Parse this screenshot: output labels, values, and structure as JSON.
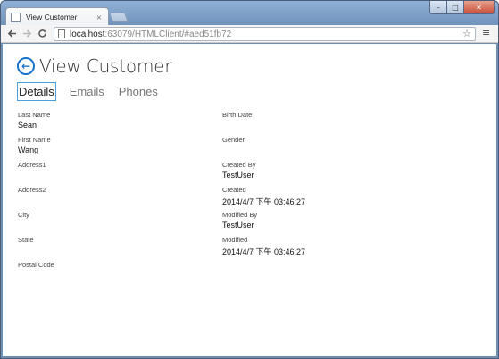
{
  "browser": {
    "tab_title": "View Customer",
    "tab_close": "×",
    "window_controls": {
      "minimize": "–",
      "maximize": "□",
      "close": "✕"
    },
    "url_host": "localhost",
    "url_rest": ":63079/HTMLClient/#aed51fb72",
    "icons": {
      "back": "back-arrow-icon",
      "forward": "forward-arrow-icon",
      "reload": "reload-icon",
      "star": "star-icon",
      "menu": "menu-icon",
      "page": "page-icon"
    }
  },
  "screen": {
    "title": "View Customer",
    "back_icon": "←",
    "accent_color": "#1b73c9",
    "tabs": [
      {
        "label": "Details",
        "active": true
      },
      {
        "label": "Emails",
        "active": false
      },
      {
        "label": "Phones",
        "active": false
      }
    ]
  },
  "details": {
    "left": [
      {
        "label": "Last Name",
        "value": "Sean"
      },
      {
        "label": "First Name",
        "value": "Wang"
      },
      {
        "label": "Address1",
        "value": ""
      },
      {
        "label": "Address2",
        "value": ""
      },
      {
        "label": "City",
        "value": ""
      },
      {
        "label": "State",
        "value": ""
      },
      {
        "label": "Postal Code",
        "value": ""
      }
    ],
    "right": [
      {
        "label": "Birth Date",
        "value": ""
      },
      {
        "label": "Gender",
        "value": ""
      },
      {
        "label": "Created By",
        "value": "TestUser"
      },
      {
        "label": "Created",
        "value": "2014/4/7 下午 03:46:27"
      },
      {
        "label": "Modified By",
        "value": "TestUser"
      },
      {
        "label": "Modified",
        "value": "2014/4/7 下午 03:46:27"
      }
    ]
  }
}
